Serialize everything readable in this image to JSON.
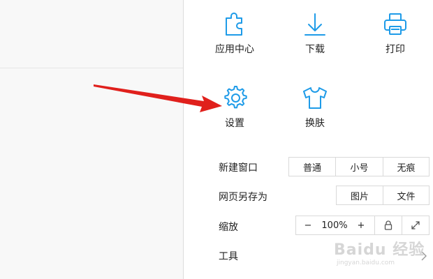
{
  "menu": {
    "grid": [
      {
        "label": "应用中心",
        "icon": "puzzle-icon"
      },
      {
        "label": "下载",
        "icon": "download-icon"
      },
      {
        "label": "打印",
        "icon": "printer-icon"
      },
      {
        "label": "设置",
        "icon": "gear-icon"
      },
      {
        "label": "换肤",
        "icon": "tshirt-icon"
      }
    ],
    "new_window": {
      "label": "新建窗口",
      "options": [
        "普通",
        "小号",
        "无痕"
      ]
    },
    "save_as": {
      "label": "网页另存为",
      "options": [
        "图片",
        "文件"
      ]
    },
    "zoom": {
      "label": "缩放",
      "minus": "−",
      "value": "100%",
      "plus": "+",
      "lock_icon": "lock-icon",
      "fullscreen_icon": "expand-icon"
    },
    "tools": {
      "label": "工具",
      "icon": "chevron-right-icon"
    }
  },
  "annotation": {
    "arrow_color": "#e0201c"
  },
  "watermark": {
    "brand": "Baidu 经验",
    "url": "jingyan.baidu.com"
  },
  "colors": {
    "accent": "#1e9be8",
    "border": "#d9d9d9"
  }
}
